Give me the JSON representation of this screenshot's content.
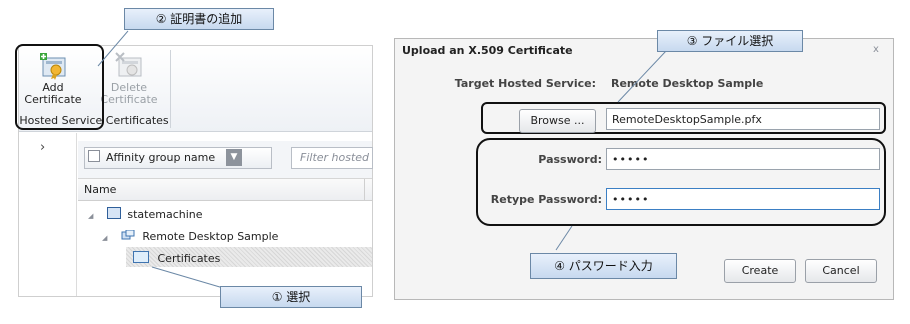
{
  "callouts": {
    "add": "② 証明書の追加",
    "select": "① 選択",
    "file": "③ ファイル選択",
    "password": "④ パスワード入力"
  },
  "ribbon": {
    "add_label_1": "Add",
    "add_label_2": "Certificate",
    "delete_label_1": "Delete",
    "delete_label_2": "Certificate",
    "group_label": "Hosted Service Certificates"
  },
  "nav": {
    "chevron": "›"
  },
  "toolbar": {
    "affinity_label": "Affinity group name",
    "filter_placeholder": "Filter hosted"
  },
  "list": {
    "column_name": "Name",
    "items": [
      {
        "label": "statemachine",
        "icon": "subscription-icon"
      },
      {
        "label": "Remote Desktop Sample",
        "icon": "hosted-service-icon"
      },
      {
        "label": "Certificates",
        "icon": "folder-icon"
      }
    ]
  },
  "dialog": {
    "title": "Upload an X.509 Certificate",
    "close": "x",
    "target_label": "Target Hosted Service:",
    "target_value": "Remote Desktop Sample",
    "browse_label": "Browse ...",
    "file_value": "RemoteDesktopSample.pfx",
    "password_label": "Password:",
    "password_value": "•••••",
    "retype_label": "Retype Password:",
    "retype_value": "•••••",
    "create_label": "Create",
    "cancel_label": "Cancel"
  }
}
